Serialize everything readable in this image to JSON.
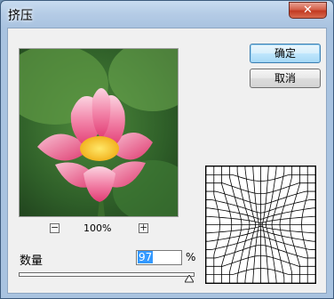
{
  "window": {
    "title": "挤压",
    "close_glyph": "✕"
  },
  "buttons": {
    "ok_label": "确定",
    "cancel_label": "取消"
  },
  "preview": {
    "zoom_minus": "−",
    "zoom_value": "100%",
    "zoom_plus": "+"
  },
  "amount": {
    "label": "数量",
    "value": "97",
    "unit": "%",
    "slider_fraction": 0.97
  },
  "icons": {
    "close": "close-icon",
    "zoom_out": "minus-icon",
    "zoom_in": "plus-icon",
    "slider_thumb": "triangle-icon"
  },
  "colors": {
    "selection": "#3399ff",
    "default_button_border": "#3c7fb1"
  }
}
